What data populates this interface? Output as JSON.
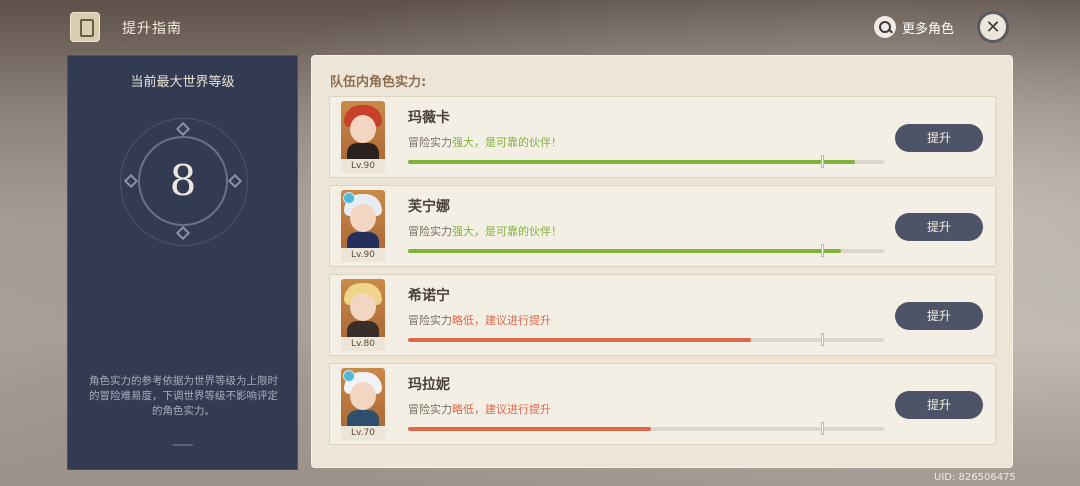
{
  "header": {
    "title": "提升指南",
    "more_characters_label": "更多角色"
  },
  "left_panel": {
    "title": "当前最大世界等级",
    "world_level": "8",
    "note": "角色实力的参考依据为世界等级为上限时的冒险难易度，下调世界等级不影响评定的角色实力。"
  },
  "right_panel": {
    "heading": "队伍内角色实力:",
    "characters": [
      {
        "name": "玛薇卡",
        "level": "Lv.90",
        "status_prefix": "冒险实力",
        "status_grade": "强大，是可靠的伙伴！",
        "button_label": "提升",
        "progress": 0.94,
        "marker": 0.87
      },
      {
        "name": "芙宁娜",
        "level": "Lv.90",
        "status_prefix": "冒险实力",
        "status_grade": "强大，是可靠的伙伴！",
        "button_label": "提升",
        "progress": 0.91,
        "marker": 0.87
      },
      {
        "name": "希诺宁",
        "level": "Lv.80",
        "status_prefix": "冒险实力",
        "status_grade": "略低，建议进行提升",
        "button_label": "提升",
        "progress": 0.72,
        "marker": 0.87
      },
      {
        "name": "玛拉妮",
        "level": "Lv.70",
        "status_prefix": "冒险实力",
        "status_grade": "略低，建议进行提升",
        "button_label": "提升",
        "progress": 0.51,
        "marker": 0.87
      }
    ]
  },
  "footer": {
    "uid": "UID: 826506475"
  },
  "colors": {
    "good": "#82b23e",
    "low": "#e26748",
    "button": "#4e5467",
    "panel_dark": "#323b51",
    "panel_light": "#ece5d8"
  }
}
